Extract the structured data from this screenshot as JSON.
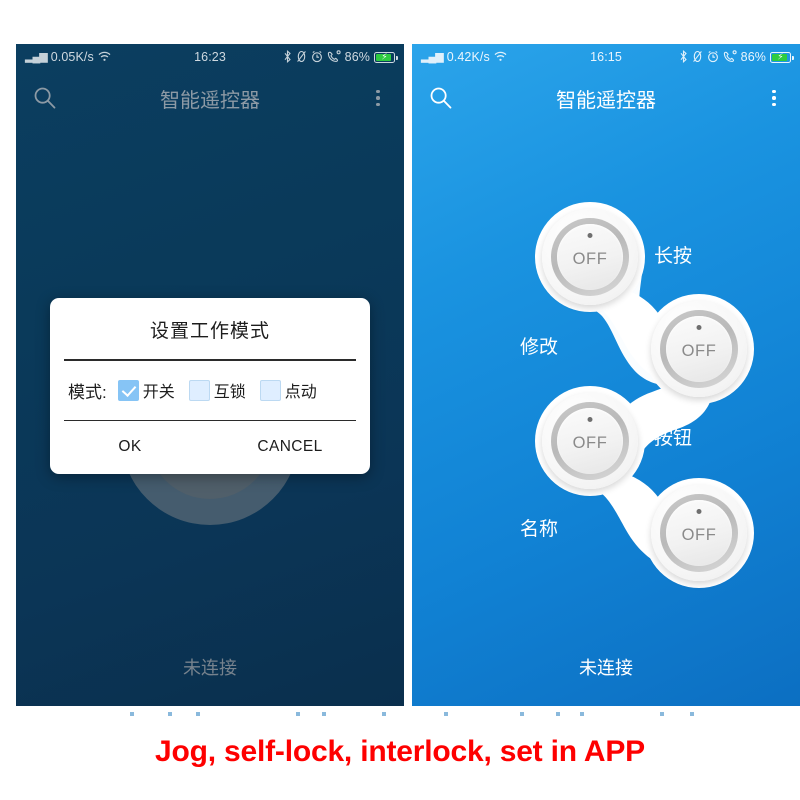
{
  "caption": "Jog, self-lock, interlock, set in APP",
  "phones": [
    {
      "id": "left",
      "status_bar": {
        "network_speed": "0.05K/s",
        "time": "16:23",
        "battery_percent": "86%",
        "icons_left": [
          "signal-icon",
          "wifi-icon"
        ],
        "icons_right": [
          "bluetooth-icon",
          "mute-icon",
          "alarm-icon",
          "call-icon",
          "battery-icon"
        ]
      },
      "app_bar": {
        "search_icon": "search-icon",
        "title": "智能遥控器",
        "overflow_icon": "kebab-menu-icon"
      },
      "footer_status": "未连接",
      "dialog": {
        "title": "设置工作模式",
        "field_label": "模式:",
        "options": [
          {
            "label": "开关",
            "checked": true
          },
          {
            "label": "互锁",
            "checked": false
          },
          {
            "label": "点动",
            "checked": false
          }
        ],
        "ok_label": "OK",
        "cancel_label": "CANCEL"
      }
    },
    {
      "id": "right",
      "status_bar": {
        "network_speed": "0.42K/s",
        "time": "16:15",
        "battery_percent": "86%",
        "icons_left": [
          "signal-icon",
          "wifi-icon"
        ],
        "icons_right": [
          "bluetooth-icon",
          "mute-icon",
          "alarm-icon",
          "call-icon",
          "battery-icon"
        ]
      },
      "app_bar": {
        "search_icon": "search-icon",
        "title": "智能遥控器",
        "overflow_icon": "kebab-menu-icon"
      },
      "footer_status": "未连接",
      "remote": {
        "buttons": [
          {
            "state": "OFF"
          },
          {
            "state": "OFF"
          },
          {
            "state": "OFF"
          },
          {
            "state": "OFF"
          }
        ],
        "labels": [
          "长按",
          "修改",
          "按钮",
          "名称"
        ]
      }
    }
  ],
  "colors": {
    "caption_red": "#fe0000",
    "phone_left_bg": "#0a3a5a",
    "phone_right_bg": "#1a93e0",
    "checkbox_checked": "#86c4f5",
    "checkbox_unchecked": "#dfeeff",
    "battery_green": "#2ecc40"
  }
}
